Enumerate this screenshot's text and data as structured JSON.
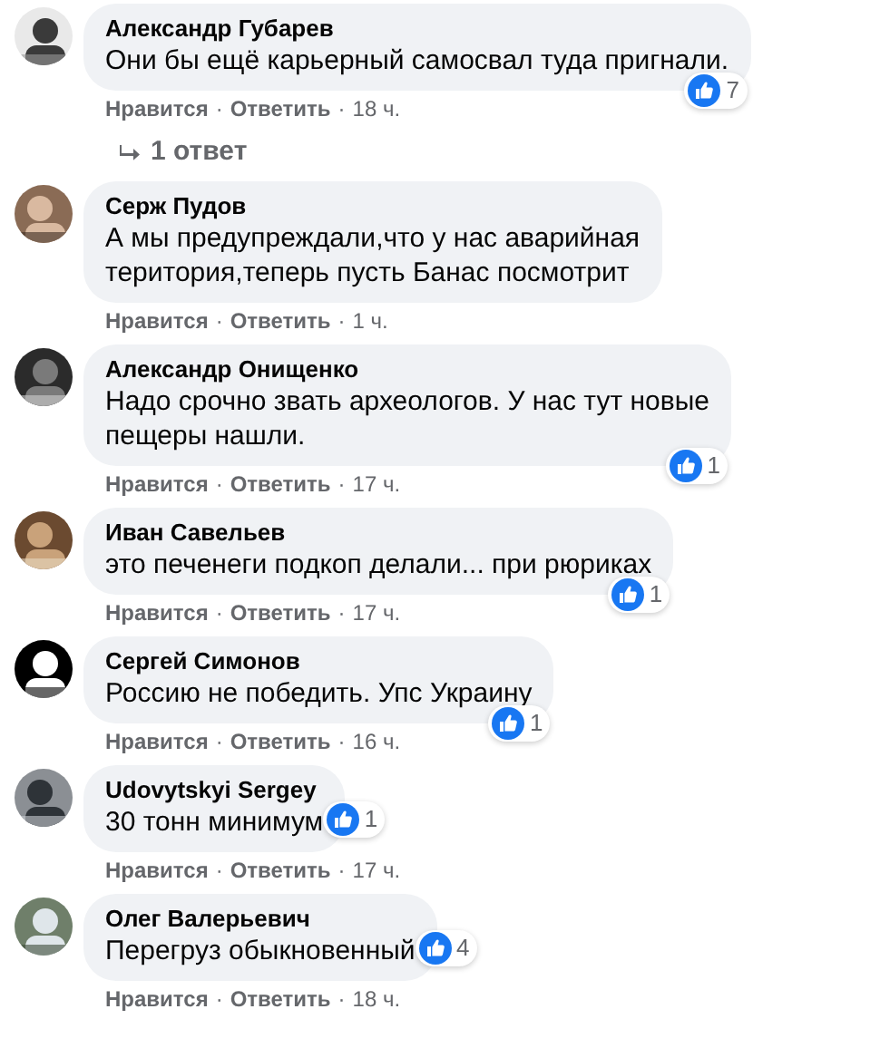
{
  "separator": "·",
  "comments": [
    {
      "author": "Александр Губарев",
      "text": "Они бы ещё карьерный самосвал туда пригнали.",
      "reactions": "7",
      "like": "Нравится",
      "reply": "Ответить",
      "time": "18 ч.",
      "replies": "1 ответ"
    },
    {
      "author": "Серж Пудов",
      "text": "А мы предупреждали,что у нас аварийная\nтеритория,теперь пусть Банас посмотрит",
      "like": "Нравится",
      "reply": "Ответить",
      "time": "1 ч."
    },
    {
      "author": "Александр Онищенко",
      "text": "Надо срочно звать археологов. У нас тут новые\nпещеры нашли.",
      "reactions": "1",
      "like": "Нравится",
      "reply": "Ответить",
      "time": "17 ч."
    },
    {
      "author": "Иван Савельев",
      "text": "это печенеги подкоп делали... при рюриках",
      "reactions": "1",
      "like": "Нравится",
      "reply": "Ответить",
      "time": "17 ч."
    },
    {
      "author": "Сергей Симонов",
      "text": "Россию не победить. Упс Украину",
      "reactions": "1",
      "like": "Нравится",
      "reply": "Ответить",
      "time": "16 ч."
    },
    {
      "author": "Udovytskyi Sergey",
      "text": "30 тонн минимум",
      "reactions": "1",
      "like": "Нравится",
      "reply": "Ответить",
      "time": "17 ч."
    },
    {
      "author": "Олег Валерьевич",
      "text": "Перегруз обыкновенный",
      "reactions": "4",
      "like": "Нравится",
      "reply": "Ответить",
      "time": "18 ч."
    }
  ]
}
